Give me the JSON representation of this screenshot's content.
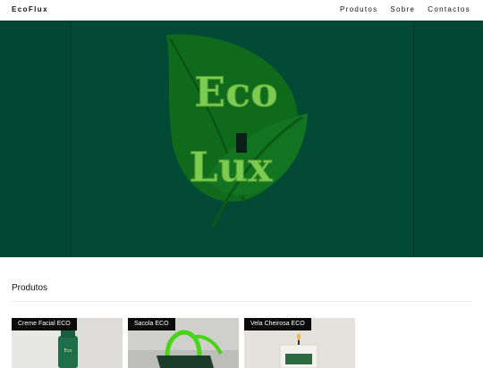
{
  "nav": {
    "brand": "EcoFlux",
    "links": [
      "Produtos",
      "Sobre",
      "Contactos"
    ]
  },
  "hero": {
    "logo_text_line1": "Eco",
    "logo_text_line2": "Lux",
    "logo_icon": "leaf-logo"
  },
  "products": {
    "title": "Produtos",
    "items": [
      {
        "label": "Creme Facial ECO",
        "icon": "cream-tube"
      },
      {
        "label": "Sacola ECO",
        "icon": "tote-bag"
      },
      {
        "label": "Vela Cheirosa ECO",
        "icon": "candle-jar"
      }
    ]
  },
  "colors": {
    "hero_bg": "#024734",
    "leaf_dark": "#0f6a1c",
    "leaf_light": "#7ccc52",
    "nav_bg": "#ffffff"
  }
}
